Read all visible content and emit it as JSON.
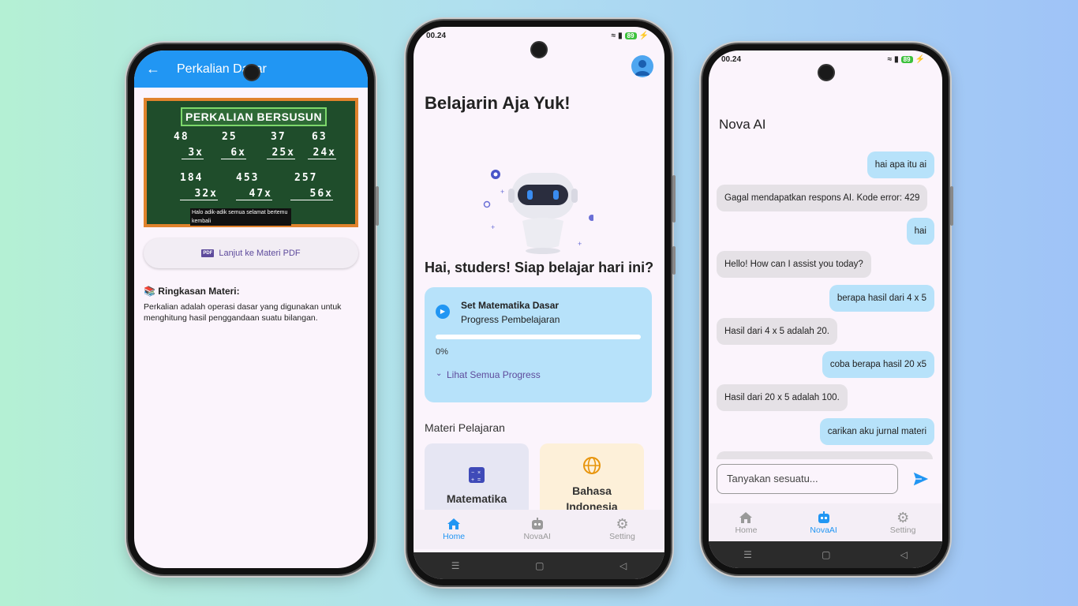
{
  "colors": {
    "primary": "#2196f3",
    "user_bubble": "#b7e2fa",
    "bot_bubble": "#e5e1e6",
    "accent_purple": "#5e4b9c",
    "board_green": "#1f4d2b",
    "board_frame": "#e0822c"
  },
  "lesson": {
    "title": "Perkalian Dasar",
    "back_icon": "arrow-left-icon",
    "board": {
      "title": "PERKALIAN BERSUSUN",
      "row1": [
        {
          "top": "48",
          "bottom": "3x"
        },
        {
          "top": "25",
          "bottom": "6x"
        },
        {
          "top": "37",
          "bottom": "25x"
        },
        {
          "top": "63",
          "bottom": "24x"
        }
      ],
      "row2": [
        {
          "top": "184",
          "bottom": "32x"
        },
        {
          "top": "453",
          "bottom": "47x"
        },
        {
          "top": "257",
          "bottom": "56x"
        }
      ],
      "caption": "Halo adik-adik semua selamat bertemu kembali"
    },
    "pdf_button": "Lanjut ke Materi PDF",
    "summary_title": "📚 Ringkasan Materi:",
    "summary_text": "Perkalian adalah operasi dasar yang digunakan untuk menghitung hasil penggandaan suatu bilangan."
  },
  "home": {
    "status_time": "00.24",
    "battery": "89",
    "title": "Belajarin Aja Yuk!",
    "greeting": "Hai, studers! Siap belajar hari ini?",
    "progress_card": {
      "title": "Set Matematika Dasar",
      "subtitle": "Progress Pembelajaran",
      "percent_label": "0%",
      "progress_value": 0,
      "more": "Lihat Semua Progress"
    },
    "section_title": "Materi Pelajaran",
    "subjects": [
      {
        "label": "Matematika",
        "icon": "calculator-icon"
      },
      {
        "label": "Bahasa Indonesia",
        "icon": "globe-icon"
      }
    ],
    "nav": [
      {
        "label": "Home",
        "icon": "home-icon",
        "active": true
      },
      {
        "label": "NovaAI",
        "icon": "robot-icon",
        "active": false
      },
      {
        "label": "Setting",
        "icon": "gear-icon",
        "active": false
      }
    ]
  },
  "chat": {
    "status_time": "00.24",
    "battery": "89",
    "title": "Nova AI",
    "messages": [
      {
        "role": "user",
        "text": "hai apa itu ai"
      },
      {
        "role": "bot",
        "text": "Gagal mendapatkan respons AI. Kode error: 429"
      },
      {
        "role": "user",
        "text": "hai"
      },
      {
        "role": "bot",
        "text": "Hello! How can I assist you today?"
      },
      {
        "role": "user",
        "text": "berapa hasil dari 4 x 5"
      },
      {
        "role": "bot",
        "text": "Hasil dari 4 x 5 adalah 20."
      },
      {
        "role": "user",
        "text": "coba berapa hasil 20 x5"
      },
      {
        "role": "bot",
        "text": "Hasil dari 20 x 5 adalah 100."
      },
      {
        "role": "user",
        "text": "carikan aku jurnal materi"
      }
    ],
    "input_placeholder": "Tanyakan sesuatu...",
    "nav": [
      {
        "label": "Home",
        "icon": "home-icon",
        "active": false
      },
      {
        "label": "NovaAI",
        "icon": "robot-icon",
        "active": true
      },
      {
        "label": "Setting",
        "icon": "gear-icon",
        "active": false
      }
    ]
  }
}
